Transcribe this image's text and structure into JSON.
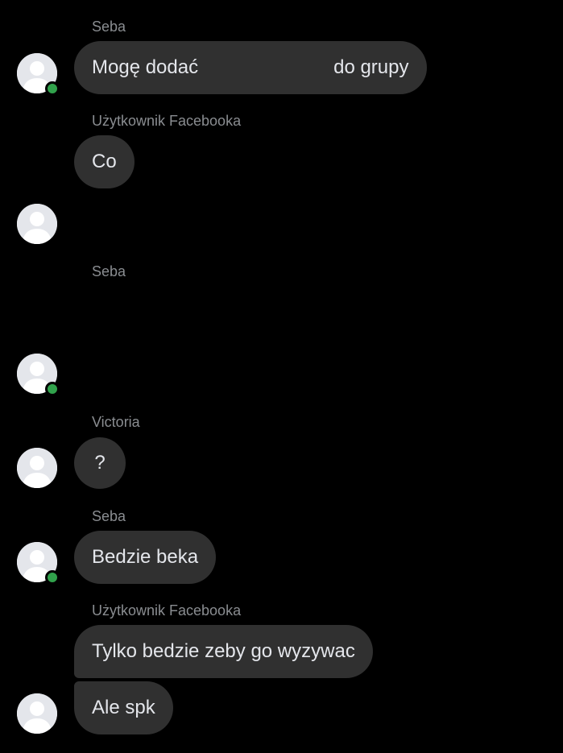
{
  "messages": [
    {
      "sender": "Seba",
      "text_start": "Mogę dodać",
      "text_end": "do grupy"
    },
    {
      "sender": "Użytkownik Facebooka",
      "text": "Co"
    },
    {
      "sender": "Seba"
    },
    {
      "sender": "Victoria",
      "text": "?"
    },
    {
      "sender": "Seba",
      "text": "Bedzie beka"
    },
    {
      "sender": "Użytkownik Facebooka",
      "text": "Tylko bedzie zeby go wyzywac"
    },
    {
      "text": "Ale spk"
    }
  ],
  "icons": {
    "avatar": "default-profile-icon",
    "presence": "online-status-dot"
  },
  "colors": {
    "background": "#000000",
    "bubble": "#303030",
    "bubble_text": "#e4e6eb",
    "sender_text": "#8a8d91",
    "presence": "#31a24c"
  }
}
